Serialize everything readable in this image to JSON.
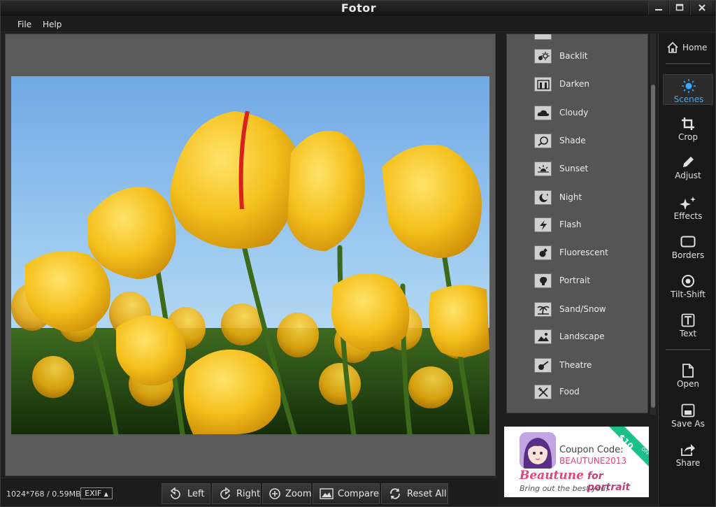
{
  "window": {
    "title": "Fotor"
  },
  "menu": {
    "file": "File",
    "help": "Help"
  },
  "status": {
    "image_info": "1024*768 / 0.59MB",
    "exif_label": "EXIF"
  },
  "toolbar": {
    "left": "Left",
    "right": "Right",
    "zoom": "Zoom",
    "compare": "Compare",
    "reset_all": "Reset All"
  },
  "scenes": {
    "items": [
      {
        "label": "Backlit",
        "icon": "backlit-icon"
      },
      {
        "label": "Darken",
        "icon": "darken-icon"
      },
      {
        "label": "Cloudy",
        "icon": "cloud-icon"
      },
      {
        "label": "Shade",
        "icon": "shade-icon"
      },
      {
        "label": "Sunset",
        "icon": "sunset-icon"
      },
      {
        "label": "Night",
        "icon": "moon-icon"
      },
      {
        "label": "Flash",
        "icon": "flash-icon"
      },
      {
        "label": "Fluorescent",
        "icon": "bulb-icon"
      },
      {
        "label": "Portrait",
        "icon": "portrait-icon"
      },
      {
        "label": "Sand/Snow",
        "icon": "palm-icon"
      },
      {
        "label": "Landscape",
        "icon": "landscape-icon"
      },
      {
        "label": "Theatre",
        "icon": "guitar-icon"
      },
      {
        "label": "Food",
        "icon": "cutlery-icon"
      }
    ]
  },
  "ad": {
    "coupon_label": "Coupon Code:",
    "coupon_code": "BEAUTUNE2013",
    "brand": "Beautune",
    "brand_suffix": "for portrait",
    "tagline": "Bring out the best you!",
    "ribbon": "$10",
    "ribbon_sub": "OFF"
  },
  "nav": {
    "home": "Home",
    "scenes": "Scenes",
    "crop": "Crop",
    "adjust": "Adjust",
    "effects": "Effects",
    "borders": "Borders",
    "tilt_shift": "Tilt-Shift",
    "text": "Text",
    "open": "Open",
    "save_as": "Save As",
    "share": "Share"
  },
  "colors": {
    "accent": "#35a8ff",
    "panel": "#555555",
    "background": "#1e1e1e",
    "ad_pink": "#e3447e",
    "ribbon_green": "#1abf8a"
  }
}
